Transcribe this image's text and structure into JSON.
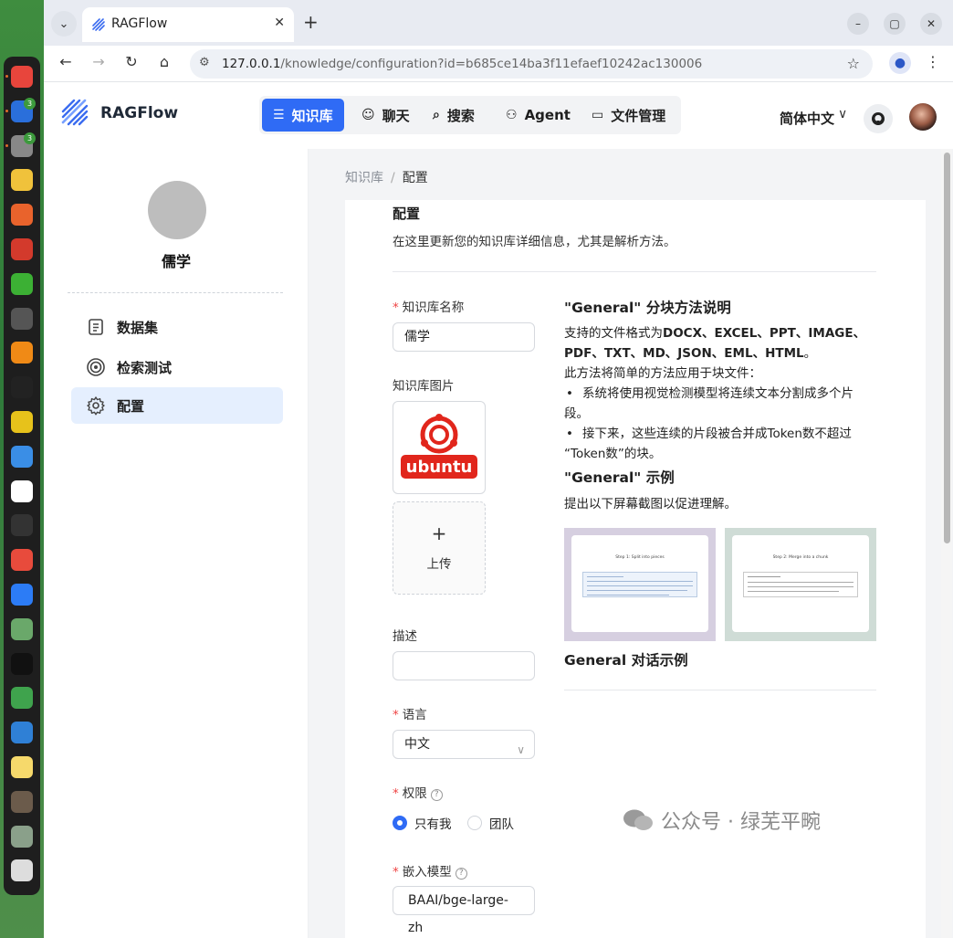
{
  "colors": {
    "accent": "#2f6bf5",
    "active_side_bg": "#e5effe",
    "required": "#ef4444"
  },
  "dock": {
    "items": [
      {
        "name": "chrome-icon",
        "color": "#e8453c"
      },
      {
        "name": "thunderbird-icon",
        "color": "#2a6fdb",
        "badge": "3"
      },
      {
        "name": "files-icon",
        "color": "#888888",
        "badge": "3"
      },
      {
        "name": "rhythmbox-icon",
        "color": "#f0c23b"
      },
      {
        "name": "appcenter-icon",
        "color": "#e9632c"
      },
      {
        "name": "wps-icon",
        "color": "#d33a2c"
      },
      {
        "name": "wechat-icon",
        "color": "#3cb034"
      },
      {
        "name": "search-icon",
        "color": "#555555"
      },
      {
        "name": "vlc-icon",
        "color": "#f08a16"
      },
      {
        "name": "qq-icon",
        "color": "#222222"
      },
      {
        "name": "lingo-icon",
        "color": "#e7c21b"
      },
      {
        "name": "feishu-icon",
        "color": "#3a8ee6"
      },
      {
        "name": "chatgpt-icon",
        "color": "#ffffff"
      },
      {
        "name": "terminal-icon",
        "color": "#333333"
      },
      {
        "name": "xmind-icon",
        "color": "#e84b3c"
      },
      {
        "name": "tencent-meeting-icon",
        "color": "#2c7cf6"
      },
      {
        "name": "layers-icon",
        "color": "#6aa86a"
      },
      {
        "name": "jetbrains-icon",
        "color": "#111111"
      },
      {
        "name": "sync-icon",
        "color": "#3fa34d"
      },
      {
        "name": "vscode-icon",
        "color": "#2f80d6"
      },
      {
        "name": "text-editor-icon",
        "color": "#f6d96b"
      },
      {
        "name": "gimp-icon",
        "color": "#6b5b4b"
      },
      {
        "name": "trash-icon",
        "color": "#8aa08a"
      },
      {
        "name": "ubuntu-apps-icon",
        "color": "#dddddd"
      }
    ]
  },
  "browser": {
    "tab_title": "RAGFlow",
    "url_host": "127.0.0.1",
    "url_path": "/knowledge/configuration?id=b685ce14ba3f11efaef10242ac130006"
  },
  "header": {
    "logo_text": "RAGFlow",
    "nav": [
      {
        "label": "知识库",
        "icon": "database-icon",
        "active": true
      },
      {
        "label": "聊天",
        "icon": "chat-icon",
        "active": false
      },
      {
        "label": "搜索",
        "icon": "search-icon",
        "active": false
      },
      {
        "label": "Agent",
        "icon": "agent-icon",
        "active": false
      },
      {
        "label": "文件管理",
        "icon": "folder-icon",
        "active": false
      }
    ],
    "language": "简体中文"
  },
  "sidebar": {
    "kb_name": "儒学",
    "items": [
      {
        "label": "数据集",
        "icon": "document-icon",
        "active": false
      },
      {
        "label": "检索测试",
        "icon": "target-icon",
        "active": false
      },
      {
        "label": "配置",
        "icon": "gear-icon",
        "active": true
      }
    ]
  },
  "breadcrumb": {
    "root": "知识库",
    "sep": "/",
    "current": "配置"
  },
  "form": {
    "title": "配置",
    "subtitle": "在这里更新您的知识库详细信息，尤其是解析方法。",
    "name_label": "知识库名称",
    "name_value": "儒学",
    "image_label": "知识库图片",
    "image_logo_text": "ubuntu",
    "upload_label": "上传",
    "desc_label": "描述",
    "desc_value": "",
    "language_label": "语言",
    "language_value": "中文",
    "permission_label": "权限",
    "permission_options": [
      "只有我",
      "团队"
    ],
    "permission_selected": "只有我",
    "embed_label": "嵌入模型",
    "embed_value": "BAAI/bge-large-zh"
  },
  "help": {
    "title": "\"General\" 分块方法说明",
    "formats_prefix": "支持的文件格式为",
    "formats_line1": "DOCX、EXCEL、PPT、IMAGE、",
    "formats_line2": "PDF、TXT、MD、JSON、EML、HTML",
    "formats_suffix": "。",
    "method_intro": "此方法将简单的方法应用于块文件：",
    "bullet1_line1": "系统将使用视觉检测模型将连续文本分割成多个片",
    "bullet1_line2": "段。",
    "bullet2_line1": "接下来，这些连续的片段被合并成Token数不超过",
    "bullet2_line2": "“Token数”的块。",
    "example_title": "\"General\" 示例",
    "example_desc": "提出以下屏幕截图以促进理解。",
    "example1_caption": "Step 1: Split into pieces",
    "example2_caption": "Step 2: Merge into a chunk",
    "dialog_title": "General 对话示例"
  },
  "watermark": {
    "text": "公众号 · 绿芜平畹"
  }
}
